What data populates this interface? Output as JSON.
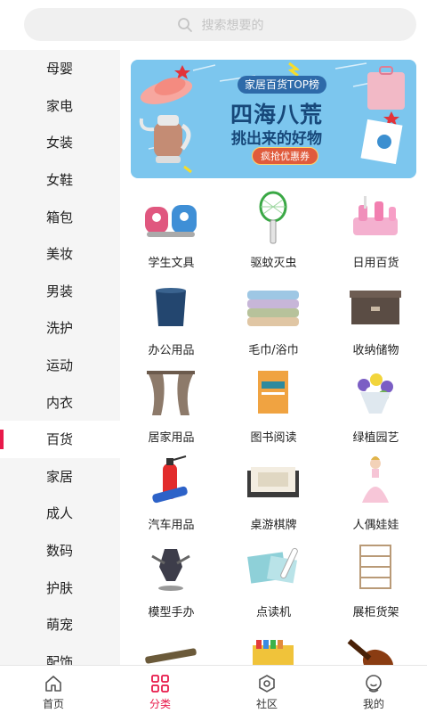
{
  "search": {
    "placeholder": "搜索想要的"
  },
  "sidebar": {
    "items": [
      {
        "label": "母婴"
      },
      {
        "label": "家电"
      },
      {
        "label": "女装"
      },
      {
        "label": "女鞋"
      },
      {
        "label": "箱包"
      },
      {
        "label": "美妆"
      },
      {
        "label": "男装"
      },
      {
        "label": "洗护"
      },
      {
        "label": "运动"
      },
      {
        "label": "内衣"
      },
      {
        "label": "百货"
      },
      {
        "label": "家居"
      },
      {
        "label": "成人"
      },
      {
        "label": "数码"
      },
      {
        "label": "护肤"
      },
      {
        "label": "萌宠"
      },
      {
        "label": "配饰"
      }
    ],
    "active_index": 10
  },
  "banner": {
    "tag": "家居百货TOP榜",
    "title": "四海八荒",
    "subtitle": "挑出来的好物",
    "button": "疯抢优惠券"
  },
  "categories": [
    {
      "label": "学生文具",
      "icon": "pencil-sharpener-icon"
    },
    {
      "label": "驱蚊灭虫",
      "icon": "mosquito-racket-icon"
    },
    {
      "label": "日用百货",
      "icon": "toothbrush-holder-icon"
    },
    {
      "label": "办公用品",
      "icon": "pen-holder-icon"
    },
    {
      "label": "毛巾/浴巾",
      "icon": "towel-stack-icon"
    },
    {
      "label": "收纳储物",
      "icon": "storage-box-icon"
    },
    {
      "label": "居家用品",
      "icon": "curtain-icon"
    },
    {
      "label": "图书阅读",
      "icon": "book-icon"
    },
    {
      "label": "绿植园艺",
      "icon": "flower-bouquet-icon"
    },
    {
      "label": "汽车用品",
      "icon": "fire-extinguisher-icon"
    },
    {
      "label": "桌游棋牌",
      "icon": "board-game-icon"
    },
    {
      "label": "人偶娃娃",
      "icon": "doll-icon"
    },
    {
      "label": "模型手办",
      "icon": "figure-icon"
    },
    {
      "label": "点读机",
      "icon": "reading-pen-icon"
    },
    {
      "label": "展柜货架",
      "icon": "shoe-rack-icon"
    },
    {
      "label": "",
      "icon": "flute-icon"
    },
    {
      "label": "",
      "icon": "crayons-icon"
    },
    {
      "label": "",
      "icon": "violin-icon"
    }
  ],
  "tabbar": {
    "home": "首页",
    "category": "分类",
    "community": "社区",
    "mine": "我的"
  },
  "colors": {
    "accent": "#e8194a",
    "banner_bg": "#7cc6ee"
  }
}
